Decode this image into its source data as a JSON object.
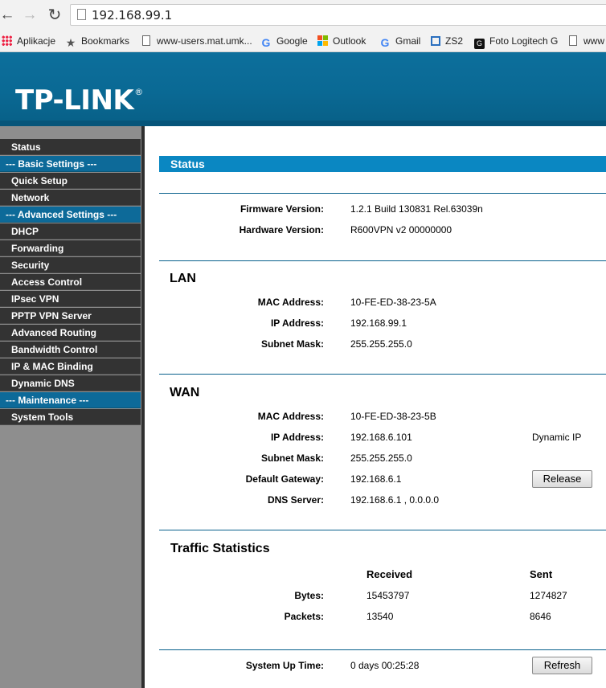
{
  "browser": {
    "url": "192.168.99.1",
    "bookmarks": [
      "Aplikacje",
      "Bookmarks",
      "www-users.mat.umk...",
      "Google",
      "Outlook",
      "Gmail",
      "ZS2",
      "Foto Logitech G",
      "www"
    ]
  },
  "header": {
    "logo": "TP-LINK",
    "logo_mark": "®"
  },
  "sidebar": {
    "items": [
      {
        "label": "Status",
        "section": false
      },
      {
        "label": "--- Basic Settings ---",
        "section": true
      },
      {
        "label": "Quick Setup",
        "section": false
      },
      {
        "label": "Network",
        "section": false
      },
      {
        "label": "--- Advanced Settings ---",
        "section": true
      },
      {
        "label": "DHCP",
        "section": false
      },
      {
        "label": "Forwarding",
        "section": false
      },
      {
        "label": "Security",
        "section": false
      },
      {
        "label": "Access Control",
        "section": false
      },
      {
        "label": "IPsec VPN",
        "section": false
      },
      {
        "label": "PPTP VPN Server",
        "section": false
      },
      {
        "label": "Advanced Routing",
        "section": false
      },
      {
        "label": "Bandwidth Control",
        "section": false
      },
      {
        "label": "IP & MAC Binding",
        "section": false
      },
      {
        "label": "Dynamic DNS",
        "section": false
      },
      {
        "label": "--- Maintenance ---",
        "section": true
      },
      {
        "label": "System Tools",
        "section": false
      }
    ]
  },
  "status": {
    "title": "Status",
    "firmware_label": "Firmware Version:",
    "firmware_value": "1.2.1 Build 130831 Rel.63039n",
    "hardware_label": "Hardware Version:",
    "hardware_value": "R600VPN v2 00000000"
  },
  "lan": {
    "title": "LAN",
    "mac_label": "MAC Address:",
    "mac_value": "10-FE-ED-38-23-5A",
    "ip_label": "IP Address:",
    "ip_value": "192.168.99.1",
    "mask_label": "Subnet Mask:",
    "mask_value": "255.255.255.0"
  },
  "wan": {
    "title": "WAN",
    "mac_label": "MAC Address:",
    "mac_value": "10-FE-ED-38-23-5B",
    "ip_label": "IP Address:",
    "ip_value": "192.168.6.101",
    "ip_type": "Dynamic IP",
    "mask_label": "Subnet Mask:",
    "mask_value": "255.255.255.0",
    "gateway_label": "Default Gateway:",
    "gateway_value": "192.168.6.1",
    "release_button": "Release",
    "dns_label": "DNS Server:",
    "dns_value": "192.168.6.1 , 0.0.0.0"
  },
  "traffic": {
    "title": "Traffic Statistics",
    "received_header": "Received",
    "sent_header": "Sent",
    "bytes_label": "Bytes:",
    "bytes_received": "15453797",
    "bytes_sent": "1274827",
    "packets_label": "Packets:",
    "packets_received": "13540",
    "packets_sent": "8646"
  },
  "uptime": {
    "label": "System Up Time:",
    "value": "0 days 00:25:28",
    "refresh_button": "Refresh"
  }
}
